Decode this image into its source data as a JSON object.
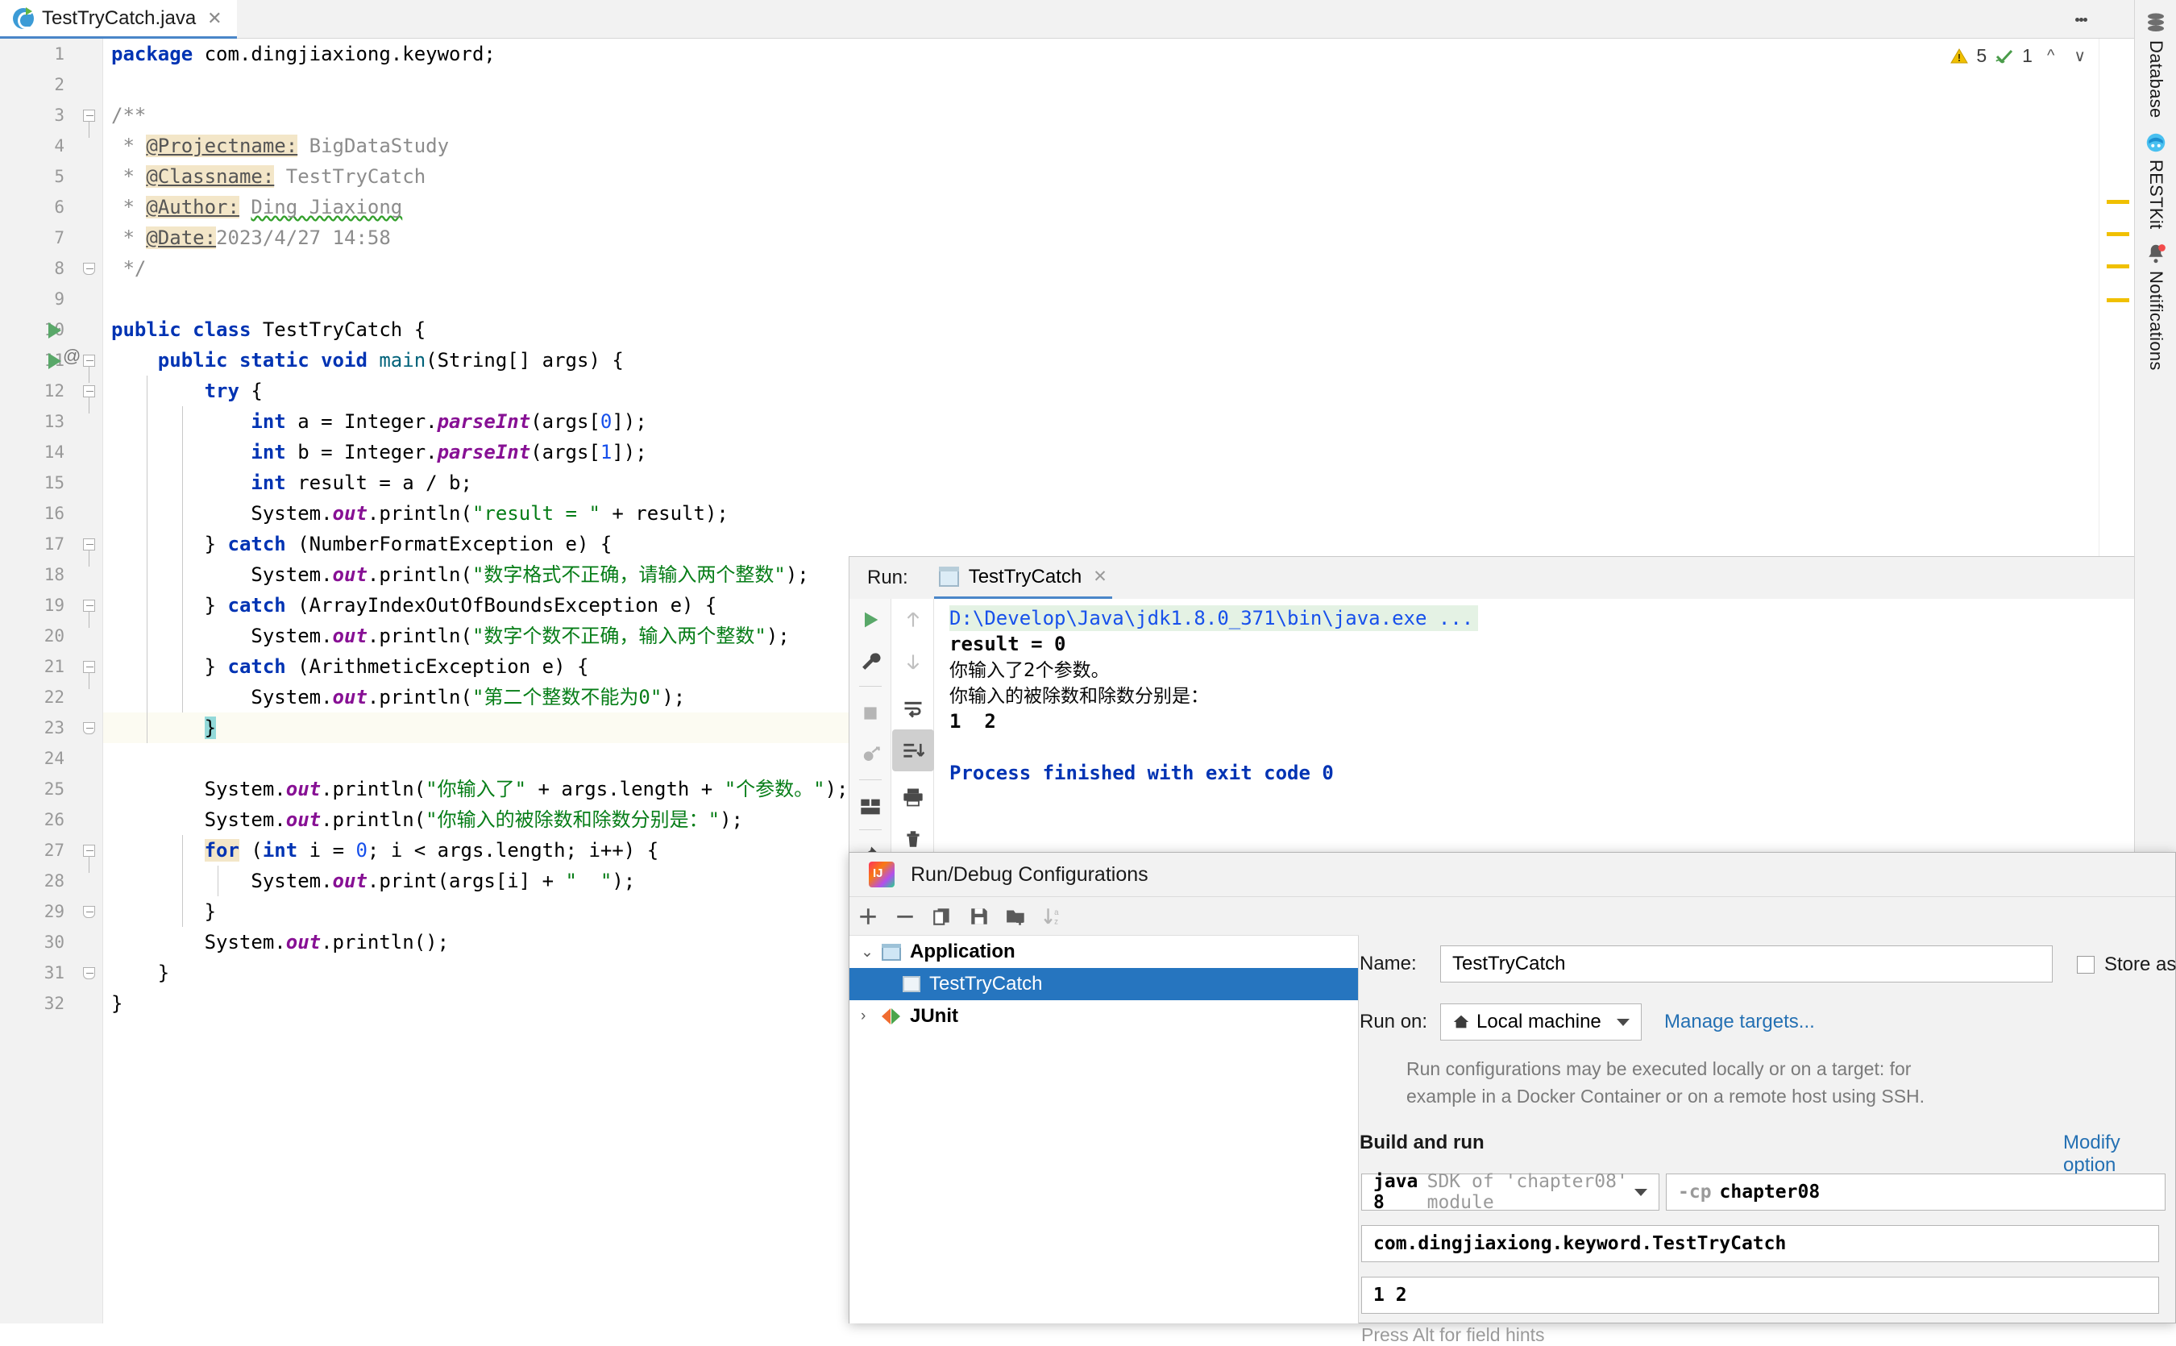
{
  "tab": {
    "filename": "TestTryCatch.java",
    "close": "✕"
  },
  "inspections": {
    "warning_count": "5",
    "ok_count": "1"
  },
  "right_strip": [
    {
      "label": "Database",
      "icon": "database-icon"
    },
    {
      "label": "RESTKit",
      "icon": "restkit-icon"
    },
    {
      "label": "Notifications",
      "icon": "notifications-bell-icon"
    }
  ],
  "editor": {
    "lines": [
      {
        "n": "1",
        "code": "package com.dingjiaxiong.keyword;"
      },
      {
        "n": "2",
        "code": ""
      },
      {
        "n": "3",
        "code": "/**"
      },
      {
        "n": "4",
        "code": " * @Projectname: BigDataStudy"
      },
      {
        "n": "5",
        "code": " * @Classname: TestTryCatch"
      },
      {
        "n": "6",
        "code": " * @Author: Ding Jiaxiong"
      },
      {
        "n": "7",
        "code": " * @Date:2023/4/27 14:58"
      },
      {
        "n": "8",
        "code": " */"
      },
      {
        "n": "9",
        "code": ""
      },
      {
        "n": "10",
        "code": "public class TestTryCatch {"
      },
      {
        "n": "11",
        "code": "    public static void main(String[] args) {"
      },
      {
        "n": "12",
        "code": "        try {"
      },
      {
        "n": "13",
        "code": "            int a = Integer.parseInt(args[0]);"
      },
      {
        "n": "14",
        "code": "            int b = Integer.parseInt(args[1]);"
      },
      {
        "n": "15",
        "code": "            int result = a / b;"
      },
      {
        "n": "16",
        "code": "            System.out.println(\"result = \" + result);"
      },
      {
        "n": "17",
        "code": "        } catch (NumberFormatException e) {"
      },
      {
        "n": "18",
        "code": "            System.out.println(\"数字格式不正确，请输入两个整数\");"
      },
      {
        "n": "19",
        "code": "        } catch (ArrayIndexOutOfBoundsException e) {"
      },
      {
        "n": "20",
        "code": "            System.out.println(\"数字个数不正确，输入两个整数\");"
      },
      {
        "n": "21",
        "code": "        } catch (ArithmeticException e) {"
      },
      {
        "n": "22",
        "code": "            System.out.println(\"第二个整数不能为0\");"
      },
      {
        "n": "23",
        "code": "        }"
      },
      {
        "n": "24",
        "code": ""
      },
      {
        "n": "25",
        "code": "        System.out.println(\"你输入了\" + args.length + \"个参数。\");"
      },
      {
        "n": "26",
        "code": "        System.out.println(\"你输入的被除数和除数分别是：\");"
      },
      {
        "n": "27",
        "code": "        for (int i = 0; i < args.length; i++) {"
      },
      {
        "n": "28",
        "code": "            System.out.print(args[i] + \"  \");"
      },
      {
        "n": "29",
        "code": "        }"
      },
      {
        "n": "30",
        "code": "        System.out.println();"
      },
      {
        "n": "31",
        "code": "    }"
      },
      {
        "n": "32",
        "code": "}"
      }
    ]
  },
  "run_window": {
    "label": "Run:",
    "tab_title": "TestTryCatch",
    "tab_close": "✕",
    "console": [
      {
        "text": "D:\\Develop\\Java\\jdk1.8.0_371\\bin\\java.exe ...",
        "style": "cmd"
      },
      {
        "text": "result = 0",
        "style": "bold"
      },
      {
        "text": "你输入了2个参数。",
        "style": "cn"
      },
      {
        "text": "你输入的被除数和除数分别是：",
        "style": "cn"
      },
      {
        "text": "1  2",
        "style": "bold"
      },
      {
        "text": "",
        "style": "plain"
      },
      {
        "text": "Process finished with exit code 0",
        "style": "finished"
      }
    ],
    "toolbar_left": [
      "run-icon",
      "wrench-icon",
      "stop-icon",
      "debug-rerun-icon",
      "layout-icon",
      "pin-icon"
    ],
    "toolbar_right": [
      "arrow-up-icon",
      "arrow-down-icon",
      "soft-wrap-icon",
      "scroll-to-end-icon",
      "print-icon",
      "trash-icon"
    ]
  },
  "dialog": {
    "title": "Run/Debug Configurations",
    "toolbar": [
      "add-icon",
      "remove-icon",
      "copy-icon",
      "save-icon",
      "new-folder-icon",
      "sort-alpha-icon"
    ],
    "tree": [
      {
        "label": "Application",
        "type": "group",
        "chevron": "⌄",
        "selected": false
      },
      {
        "label": "TestTryCatch",
        "type": "child",
        "chevron": "",
        "selected": true
      },
      {
        "label": "JUnit",
        "type": "junit",
        "chevron": "›",
        "selected": false
      }
    ],
    "name_label": "Name:",
    "name_value": "TestTryCatch",
    "store_as_label": "Store as",
    "run_on_label": "Run on:",
    "run_on_value": "Local machine",
    "manage_targets": "Manage targets...",
    "hint_line1": "Run configurations may be executed locally or on a target: for",
    "hint_line2": "example in a Docker Container or on a remote host using SSH.",
    "build_and_run": "Build and run",
    "modify_options": "Modify option",
    "sdk_prefix": "java 8",
    "sdk_rest": " SDK of 'chapter08' module",
    "cp_prefix": "-cp",
    "cp_value": "chapter08",
    "main_class": "com.dingjiaxiong.keyword.TestTryCatch",
    "program_args": "1 2",
    "field_hints": "Press Alt for field hints"
  },
  "colors": {
    "accent": "#2675bf",
    "keyword": "#0033b3",
    "string": "#067d17",
    "field": "#871094",
    "comment": "#8c8c8c",
    "run_green": "#59a869",
    "warning": "#f0c000"
  }
}
